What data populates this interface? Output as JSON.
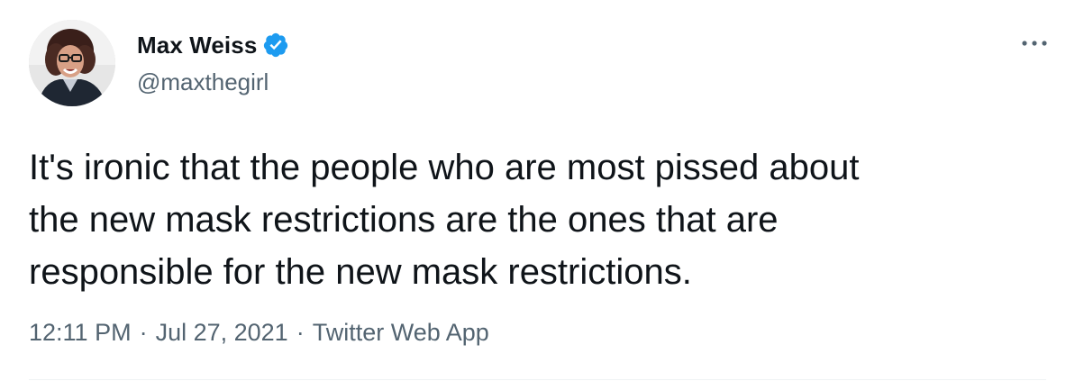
{
  "author": {
    "display_name": "Max Weiss",
    "handle": "@maxthegirl",
    "verified": true,
    "avatar_icon": "profile-photo"
  },
  "tweet": {
    "text": "It's ironic that the people who are most pissed about\nthe new mask restrictions are the ones that are\nresponsible for the new mask restrictions.",
    "time": "12:11 PM",
    "separator": "·",
    "date": "Jul 27, 2021",
    "source": "Twitter Web App"
  },
  "colors": {
    "verified_badge": "#1d9bf0",
    "secondary_text": "#536471",
    "primary_text": "#0f1419",
    "divider": "#eff3f4"
  },
  "icons": {
    "more": "more-horizontal-icon",
    "verified": "verified-badge-icon"
  }
}
